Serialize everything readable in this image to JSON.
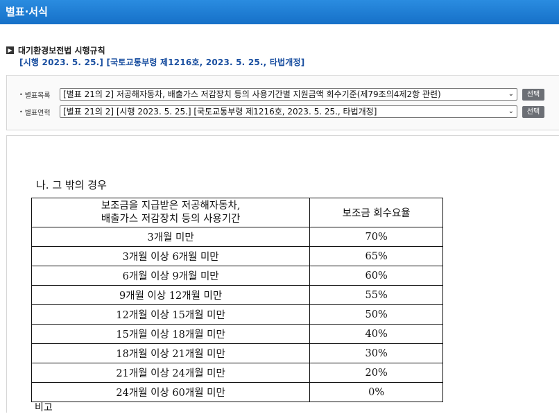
{
  "window": {
    "title": "별표·서식"
  },
  "law": {
    "name": "대기환경보전법 시행규칙",
    "enforcement": "[시행 2023. 5. 25.] [국토교통부령 제1216호, 2023. 5. 25., 타법개정]"
  },
  "selectors": [
    {
      "label": "별표목록",
      "value": "[별표 21의 2] 저공해자동차, 배출가스 저감장치 등의 사용기간별 지원금액 회수기준(제79조의4제2항 관련)",
      "button": "선택"
    },
    {
      "label": "별표연혁",
      "value": "[별표 21의 2] [시행 2023. 5. 25.] [국토교통부령 제1216호, 2023. 5. 25., 타법개정]",
      "button": "선택"
    }
  ],
  "document": {
    "section_heading": "나. 그 밖의 경우",
    "table": {
      "header_col1_line1": "보조금을 지급받은 저공해자동차,",
      "header_col1_line2": "배출가스 저감장치 등의 사용기간",
      "header_col2": "보조금 회수요율",
      "rows": [
        {
          "period": "3개월 미만",
          "rate": "70%"
        },
        {
          "period": "3개월 이상 6개월 미만",
          "rate": "65%"
        },
        {
          "period": "6개월 이상 9개월 미만",
          "rate": "60%"
        },
        {
          "period": "9개월 이상 12개월 미만",
          "rate": "55%"
        },
        {
          "period": "12개월 이상 15개월 미만",
          "rate": "50%"
        },
        {
          "period": "15개월 이상 18개월 미만",
          "rate": "40%"
        },
        {
          "period": "18개월 이상 21개월 미만",
          "rate": "30%"
        },
        {
          "period": "21개월 이상 24개월 미만",
          "rate": "20%"
        },
        {
          "period": "24개월 이상 60개월 미만",
          "rate": "0%"
        }
      ]
    },
    "footnote": "비고"
  },
  "colors": {
    "titlebar": "#1f7ed6",
    "law_sub": "#1a4fa0",
    "button": "#6c6f75"
  }
}
